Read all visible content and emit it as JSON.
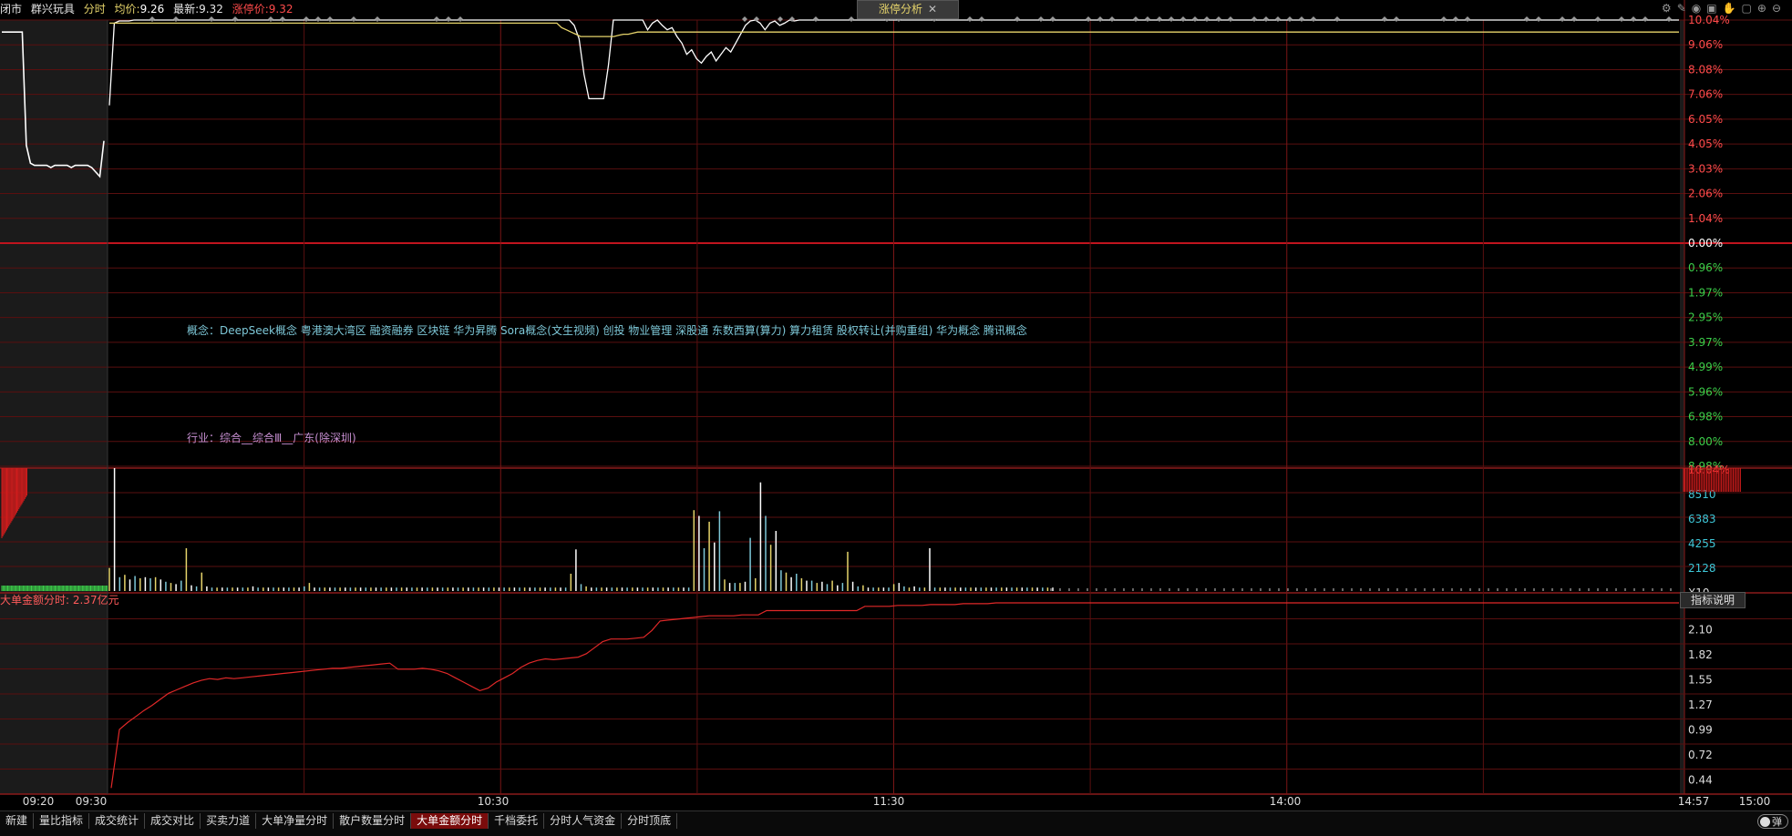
{
  "header": {
    "market": "闭市",
    "stock_name": "群兴玩具",
    "mode": "分时",
    "avg_label": "均价:",
    "avg_value": "9.26",
    "latest_label": "最新:",
    "latest_value": "9.32",
    "limit_label": "涨停价:",
    "limit_value": "9.32"
  },
  "panel_tab": {
    "title": "涨停分析",
    "close": "✕"
  },
  "toolbar_icons": [
    "gear-icon",
    "pen-icon",
    "eye-icon",
    "trash-icon",
    "hand-icon",
    "lock-icon",
    "zoom-in-icon",
    "zoom-out-icon"
  ],
  "concept_text": "概念：DeepSeek概念 粤港澳大湾区 融资融券 区块链 华为昇腾 Sora概念(文生视频) 创投 物业管理 深股通 东数西算(算力) 算力租赁 股权转让(并购重组) 华为概念 腾讯概念",
  "industry_text": "行业：综合__综合Ⅲ__广东(除深圳)",
  "sub_indicator_label": "大单金额分时: 2.37亿元",
  "explain_button": "指标说明",
  "bottom_tabs": [
    {
      "label": "新建",
      "active": false
    },
    {
      "label": "量比指标",
      "active": false
    },
    {
      "label": "成交统计",
      "active": false
    },
    {
      "label": "成交对比",
      "active": false
    },
    {
      "label": "买卖力道",
      "active": false
    },
    {
      "label": "大单净量分时",
      "active": false
    },
    {
      "label": "散户数量分时",
      "active": false
    },
    {
      "label": "大单金额分时",
      "active": true
    },
    {
      "label": "千档委托",
      "active": false
    },
    {
      "label": "分时人气资金",
      "active": false
    },
    {
      "label": "分时顶底",
      "active": false
    }
  ],
  "toggle_label": "弹",
  "colors": {
    "up": "#ff3c3c",
    "down": "#3cd04a",
    "grid": "#5a0f0f",
    "price": "#ffffff",
    "avg": "#e6d46b",
    "volume_x": "#d0d0d0"
  },
  "chart_data": [
    {
      "type": "line",
      "name": "price-panel",
      "y_ticks_up": [
        "10.04%",
        "9.06%",
        "8.08%",
        "7.06%",
        "6.05%",
        "4.05%",
        "3.03%",
        "2.06%",
        "1.04%"
      ],
      "y_tick_zero": "0.00%",
      "y_ticks_down": [
        "0.96%",
        "1.97%",
        "2.95%",
        "3.97%",
        "4.99%",
        "5.96%",
        "6.98%",
        "8.00%",
        "8.98%"
      ],
      "ylim": [
        -10.04,
        10.04
      ],
      "x_ticks": [
        "09:20",
        "09:30",
        "10:30",
        "11:30",
        "14:00",
        "14:57",
        "15:00"
      ],
      "series": [
        {
          "values_premarket": [
            9.5,
            9.5,
            9.5,
            9.5,
            9.5,
            9.5,
            4.4,
            3.6,
            3.5,
            3.5,
            3.5,
            3.5,
            3.4,
            3.5,
            3.5,
            3.5,
            3.5,
            3.4,
            3.5,
            3.5,
            3.5,
            3.5,
            3.4,
            3.2,
            3.0,
            4.6
          ],
          "values": [
            6.2,
            9.9,
            10.0,
            10.0,
            10.0,
            10.04,
            10.04,
            10.04,
            10.04,
            10.04,
            10.04,
            10.04,
            10.04,
            10.04,
            10.04,
            10.04,
            10.04,
            10.04,
            10.04,
            10.04,
            10.04,
            10.04,
            10.04,
            10.04,
            10.04,
            10.04,
            10.04,
            10.04,
            10.04,
            10.04,
            10.04,
            10.04,
            10.04,
            10.04,
            10.04,
            10.04,
            10.04,
            10.04,
            10.04,
            10.04,
            10.04,
            10.04,
            10.04,
            10.04,
            10.04,
            10.04,
            10.04,
            10.04,
            10.04,
            10.04,
            10.04,
            10.04,
            10.04,
            10.04,
            10.04,
            10.04,
            10.04,
            10.04,
            10.04,
            10.04,
            10.04,
            10.04,
            10.04,
            10.04,
            10.04,
            10.04,
            10.04,
            10.04,
            10.04,
            10.04,
            10.04,
            10.04,
            10.04,
            10.04,
            10.04,
            10.04,
            10.04,
            10.04,
            10.04,
            10.04,
            10.04,
            10.04,
            10.04,
            10.04,
            10.04,
            10.04,
            10.04,
            10.04,
            10.04,
            10.04,
            10.04,
            10.04,
            10.04,
            10.04,
            10.04,
            9.8,
            9.2,
            7.6,
            6.5,
            6.5,
            6.5,
            6.5,
            8.0,
            10.04,
            10.04,
            10.04,
            10.04,
            10.04,
            10.04,
            10.04,
            9.6,
            9.9,
            10.04,
            9.8,
            9.6,
            9.7,
            9.3,
            9.0,
            8.5,
            8.7,
            8.3,
            8.1,
            8.4,
            8.6,
            8.2,
            8.5,
            8.8,
            8.6,
            9.0,
            9.4,
            9.8,
            10.0,
            10.04,
            9.9,
            9.6,
            9.9,
            10.0,
            9.8,
            9.9,
            10.04,
            10.0,
            10.04,
            10.04,
            10.04
          ]
        },
        {
          "values": [
            9.9,
            9.9,
            9.9,
            9.9,
            9.9,
            9.9,
            9.9,
            9.9,
            9.9,
            9.9,
            9.9,
            9.9,
            9.9,
            9.9,
            9.9,
            9.9,
            9.9,
            9.9,
            9.9,
            9.9,
            9.9,
            9.9,
            9.9,
            9.9,
            9.9,
            9.9,
            9.9,
            9.9,
            9.9,
            9.9,
            9.9,
            9.9,
            9.9,
            9.9,
            9.9,
            9.9,
            9.9,
            9.9,
            9.9,
            9.9,
            9.9,
            9.9,
            9.9,
            9.9,
            9.9,
            9.9,
            9.9,
            9.9,
            9.9,
            9.9,
            9.9,
            9.9,
            9.9,
            9.9,
            9.9,
            9.9,
            9.9,
            9.9,
            9.9,
            9.9,
            9.9,
            9.9,
            9.9,
            9.9,
            9.9,
            9.9,
            9.9,
            9.9,
            9.9,
            9.9,
            9.9,
            9.9,
            9.9,
            9.9,
            9.9,
            9.9,
            9.9,
            9.9,
            9.9,
            9.9,
            9.9,
            9.9,
            9.9,
            9.9,
            9.9,
            9.9,
            9.9,
            9.9,
            9.9,
            9.9,
            9.9,
            9.9,
            9.9,
            9.9,
            9.9,
            9.7,
            9.6,
            9.5,
            9.4,
            9.3,
            9.3,
            9.3,
            9.3,
            9.3,
            9.3,
            9.3,
            9.3,
            9.35,
            9.4,
            9.4,
            9.45,
            9.5,
            9.5,
            9.5,
            9.5,
            9.5,
            9.5,
            9.5,
            9.5,
            9.5,
            9.5,
            9.5,
            9.5,
            9.5,
            9.5,
            9.5,
            9.5,
            9.5,
            9.5,
            9.5,
            9.5,
            9.5,
            9.5,
            9.5,
            9.5,
            9.5,
            9.5,
            9.5,
            9.5,
            9.5,
            9.5,
            9.5,
            9.5,
            9.5,
            9.5,
            9.5,
            9.5,
            9.5
          ]
        }
      ]
    },
    {
      "type": "bar",
      "name": "volume-panel",
      "y_ticks": [
        "10.04%",
        "8510",
        "6383",
        "4255",
        "2128",
        "X10"
      ],
      "ylim": [
        0,
        10638
      ],
      "values": [
        2000,
        10638,
        1200,
        1400,
        1000,
        1300,
        1100,
        1200,
        1100,
        1200,
        1000,
        800,
        700,
        600,
        900,
        3700,
        500,
        400,
        1600,
        400,
        300,
        300,
        300,
        300,
        300,
        300,
        300,
        300,
        400,
        300,
        300,
        300,
        300,
        300,
        300,
        300,
        300,
        300,
        400,
        700,
        300,
        300,
        300,
        300,
        300,
        300,
        300,
        300,
        300,
        300,
        300,
        300,
        300,
        300,
        300,
        300,
        300,
        300,
        300,
        300,
        300,
        300,
        300,
        300,
        300,
        300,
        300,
        300,
        300,
        300,
        300,
        300,
        300,
        300,
        300,
        300,
        300,
        300,
        300,
        300,
        300,
        300,
        300,
        300,
        300,
        300,
        300,
        300,
        300,
        300,
        1500,
        3600,
        600,
        400,
        300,
        300,
        300,
        300,
        300,
        300,
        300,
        300,
        300,
        300,
        300,
        300,
        300,
        300,
        300,
        300,
        300,
        300,
        300,
        300,
        7000,
        6500,
        3700,
        6000,
        4200,
        6900,
        1000,
        700,
        700,
        700,
        800,
        4600,
        1100,
        9400,
        6500,
        4000,
        5200,
        1800,
        1600,
        1200,
        1500,
        1100,
        900,
        900,
        700,
        800,
        600,
        900,
        500,
        700,
        3400,
        800,
        400,
        500,
        300,
        300,
        300,
        300,
        300,
        600,
        700,
        400,
        300,
        400,
        300,
        300,
        3700,
        300,
        300,
        300,
        300,
        300,
        300,
        300,
        300,
        300,
        300,
        300,
        300,
        300,
        300,
        300,
        300,
        300,
        300,
        300,
        300,
        300,
        300,
        300,
        300
      ]
    },
    {
      "type": "line",
      "name": "big-order-amount-panel",
      "y_ticks": [
        "2.37",
        "2.10",
        "1.82",
        "1.55",
        "1.27",
        "0.99",
        "0.72",
        "0.44"
      ],
      "ylim": [
        0.17,
        2.37
      ],
      "values": [
        0.22,
        0.9,
        0.98,
        1.05,
        1.12,
        1.18,
        1.25,
        1.32,
        1.36,
        1.4,
        1.44,
        1.47,
        1.49,
        1.48,
        1.5,
        1.49,
        1.5,
        1.51,
        1.52,
        1.53,
        1.54,
        1.55,
        1.56,
        1.57,
        1.58,
        1.59,
        1.6,
        1.61,
        1.61,
        1.62,
        1.63,
        1.64,
        1.65,
        1.66,
        1.67,
        1.6,
        1.6,
        1.6,
        1.61,
        1.6,
        1.58,
        1.55,
        1.5,
        1.45,
        1.4,
        1.35,
        1.38,
        1.45,
        1.5,
        1.55,
        1.62,
        1.67,
        1.7,
        1.72,
        1.71,
        1.72,
        1.73,
        1.74,
        1.78,
        1.85,
        1.92,
        1.95,
        1.95,
        1.95,
        1.96,
        1.97,
        2.05,
        2.16,
        2.17,
        2.18,
        2.19,
        2.2,
        2.21,
        2.22,
        2.22,
        2.22,
        2.22,
        2.23,
        2.23,
        2.23,
        2.28,
        2.28,
        2.28,
        2.28,
        2.28,
        2.28,
        2.28,
        2.28,
        2.28,
        2.28,
        2.28,
        2.28,
        2.33,
        2.33,
        2.33,
        2.33,
        2.34,
        2.34,
        2.34,
        2.34,
        2.35,
        2.35,
        2.35,
        2.35,
        2.36,
        2.36,
        2.36,
        2.36,
        2.37,
        2.37,
        2.37,
        2.37,
        2.37,
        2.37,
        2.37,
        2.37,
        2.37,
        2.37,
        2.37,
        2.37
      ]
    }
  ]
}
